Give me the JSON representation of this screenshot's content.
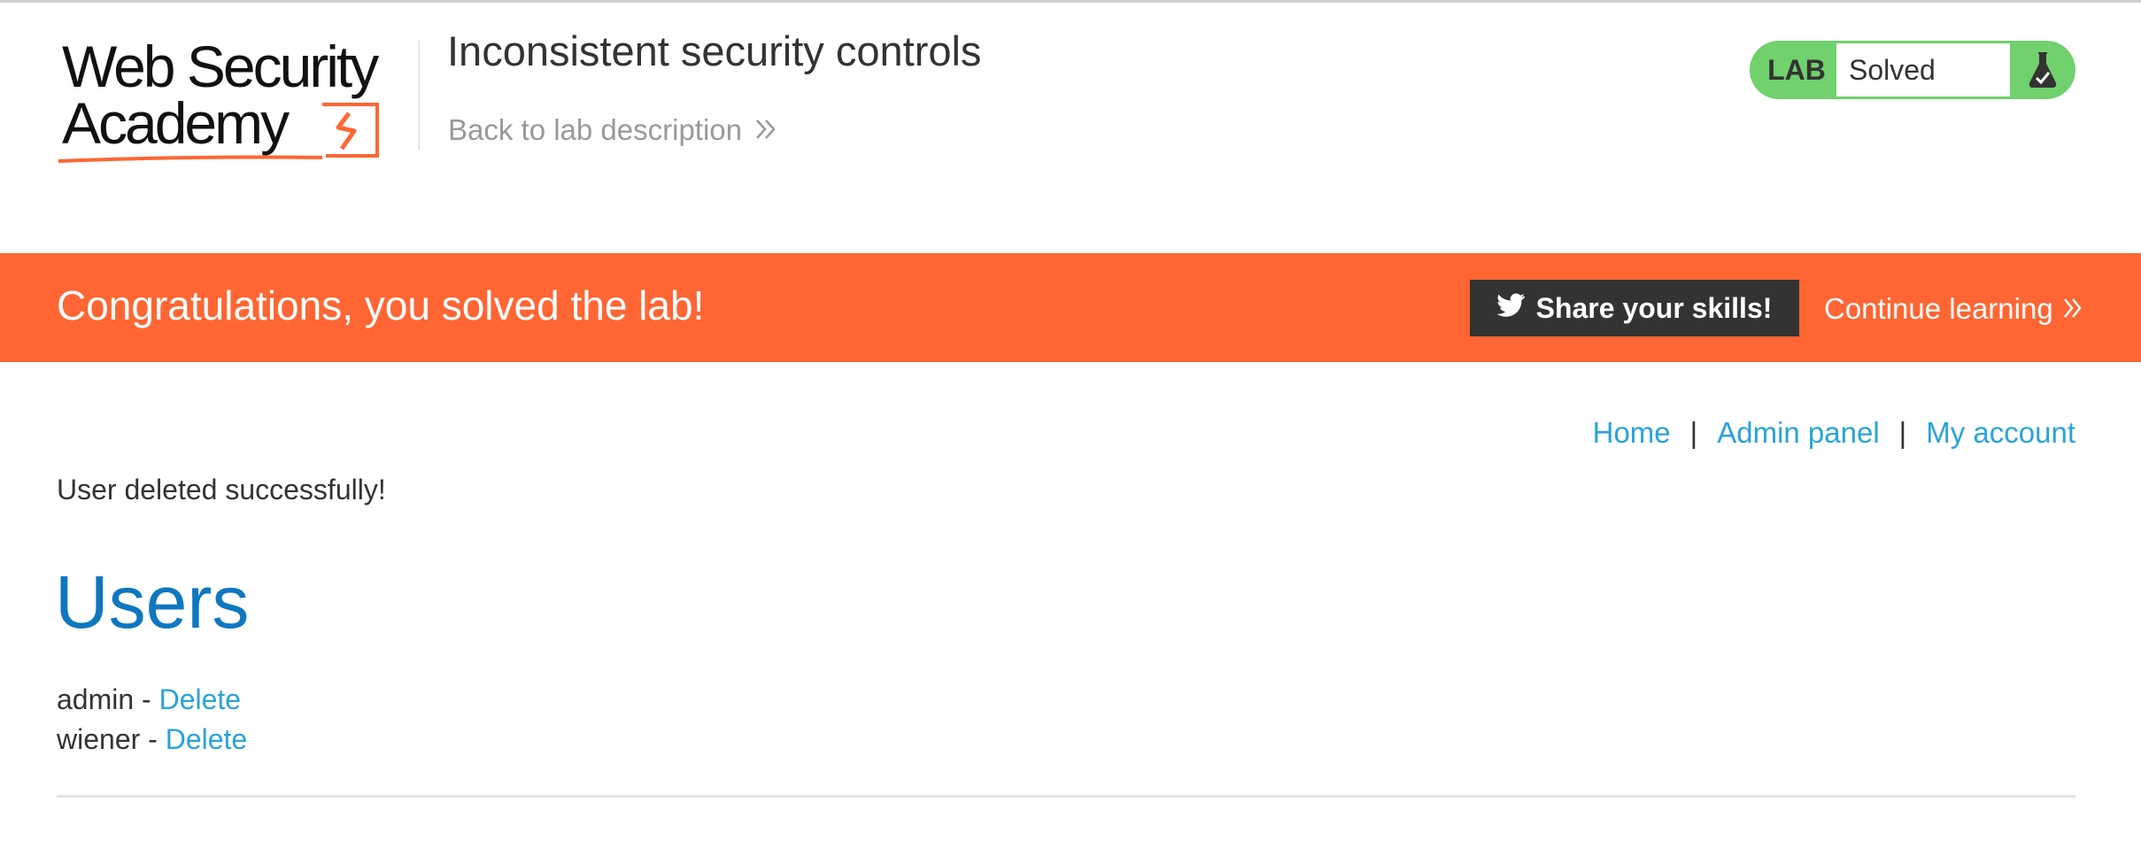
{
  "header": {
    "logo_line1": "Web Security",
    "logo_line2": "Academy",
    "lab_title": "Inconsistent security controls",
    "back_link": "Back to lab description",
    "lab_badge": {
      "label": "LAB",
      "status": "Solved",
      "icon": "flask-check-icon",
      "color": "#70d16d"
    }
  },
  "banner": {
    "message": "Congratulations, you solved the lab!",
    "share_label": "Share your skills!",
    "share_icon": "twitter-bird-icon",
    "continue_label": "Continue learning",
    "color": "#ff6633"
  },
  "nav": {
    "items": [
      {
        "label": "Home"
      },
      {
        "label": "Admin panel"
      },
      {
        "label": "My account"
      }
    ],
    "separator": "|"
  },
  "main": {
    "message": "User deleted successfully!",
    "heading": "Users",
    "users": [
      {
        "name": "admin",
        "separator": " - ",
        "action": "Delete"
      },
      {
        "name": "wiener",
        "separator": " - ",
        "action": "Delete"
      }
    ]
  },
  "colors": {
    "link": "#29a3d9",
    "heading": "#0f77bf",
    "text": "#333332"
  }
}
